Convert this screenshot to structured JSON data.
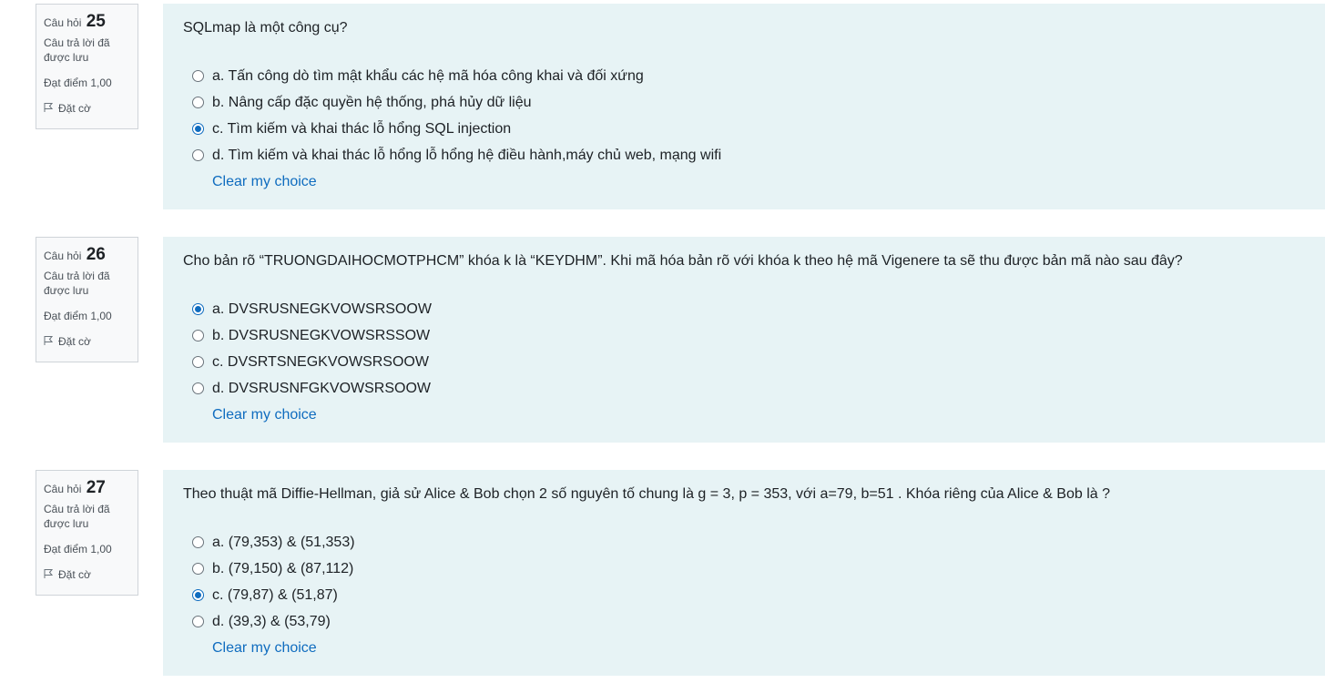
{
  "questions": [
    {
      "label": "Câu hỏi",
      "number": "25",
      "state": "Câu trả lời đã được lưu",
      "grade": "Đạt điểm 1,00",
      "flag_label": "Đặt cờ",
      "text": "SQLmap là một công cụ?",
      "selected": 2,
      "answers": [
        "a. Tấn công dò tìm mật khẩu các hệ mã hóa công khai và đối xứng",
        "b. Nâng cấp đặc quyền hệ thống, phá hủy dữ liệu",
        "c. Tìm kiếm và khai thác lỗ hổng SQL injection",
        "d. Tìm kiếm và khai thác lỗ hổng lỗ hổng hệ điều hành,máy chủ web, mạng wifi"
      ],
      "clear_label": "Clear my choice"
    },
    {
      "label": "Câu hỏi",
      "number": "26",
      "state": "Câu trả lời đã được lưu",
      "grade": "Đạt điểm 1,00",
      "flag_label": "Đặt cờ",
      "text": "Cho bản rõ “TRUONGDAIHOCMOTPHCM” khóa k là “KEYDHM”. Khi mã hóa bản rõ với khóa k theo hệ mã Vigenere ta sẽ thu được bản mã nào sau đây?",
      "selected": 0,
      "answers": [
        "a. DVSRUSNEGKVOWSRSOOW",
        "b. DVSRUSNEGKVOWSRSSOW",
        "c. DVSRTSNEGKVOWSRSOOW",
        "d. DVSRUSNFGKVOWSRSOOW"
      ],
      "clear_label": "Clear my choice"
    },
    {
      "label": "Câu hỏi",
      "number": "27",
      "state": "Câu trả lời đã được lưu",
      "grade": "Đạt điểm 1,00",
      "flag_label": "Đặt cờ",
      "text": "Theo thuật mã Diffie-Hellman, giả sử Alice & Bob chọn 2 số nguyên tố chung là g = 3, p = 353, với a=79, b=51 . Khóa riêng của Alice & Bob là ?",
      "selected": 2,
      "answers": [
        "a. (79,353) & (51,353)",
        "b. (79,150) & (87,112)",
        "c. (79,87) & (51,87)",
        "d. (39,3) & (53,79)"
      ],
      "clear_label": "Clear my choice"
    }
  ],
  "colors": {
    "content_bg": "#e7f3f5",
    "info_bg": "#f8f9fa",
    "link": "#0f6cbf",
    "radio_checked": "#0f6cbf"
  }
}
